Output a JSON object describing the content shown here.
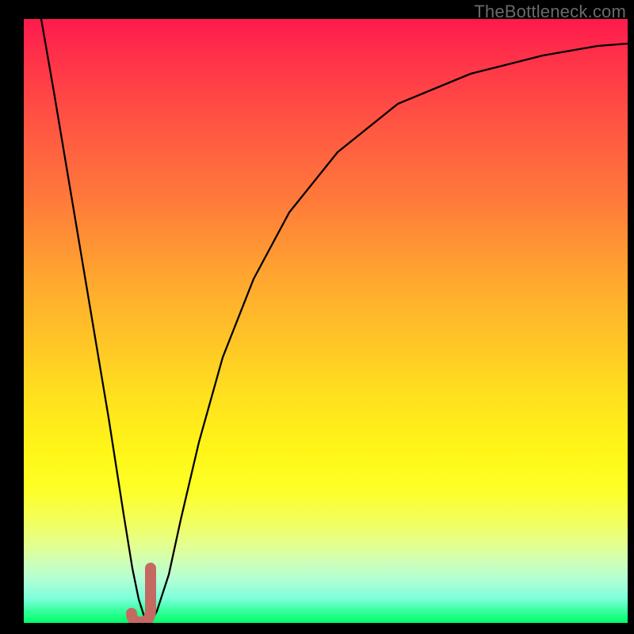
{
  "watermark": "TheBottleneck.com",
  "colors": {
    "black": "#000000",
    "curve": "#000000",
    "marker": "#c46a63"
  },
  "chart_data": {
    "type": "line",
    "title": "",
    "xlabel": "",
    "ylabel": "",
    "xlim": [
      0,
      100
    ],
    "ylim": [
      0,
      100
    ],
    "grid": false,
    "series": [
      {
        "name": "curve",
        "color": "#000000",
        "x": [
          3,
          5,
          8,
          11,
          14,
          16.5,
          18,
          19,
          20,
          21,
          22,
          24,
          26,
          29,
          33,
          38,
          44,
          52,
          62,
          74,
          86,
          95,
          100
        ],
        "y": [
          100,
          88,
          70,
          52,
          34,
          18,
          9,
          4,
          1,
          0,
          2,
          8,
          17,
          30,
          44,
          57,
          68,
          78,
          86,
          91,
          94,
          95.5,
          96
        ]
      }
    ],
    "marker": {
      "name": "j-hook",
      "color": "#c46a63",
      "x_range": [
        18.2,
        21.0
      ],
      "y_range": [
        0,
        9
      ]
    }
  }
}
